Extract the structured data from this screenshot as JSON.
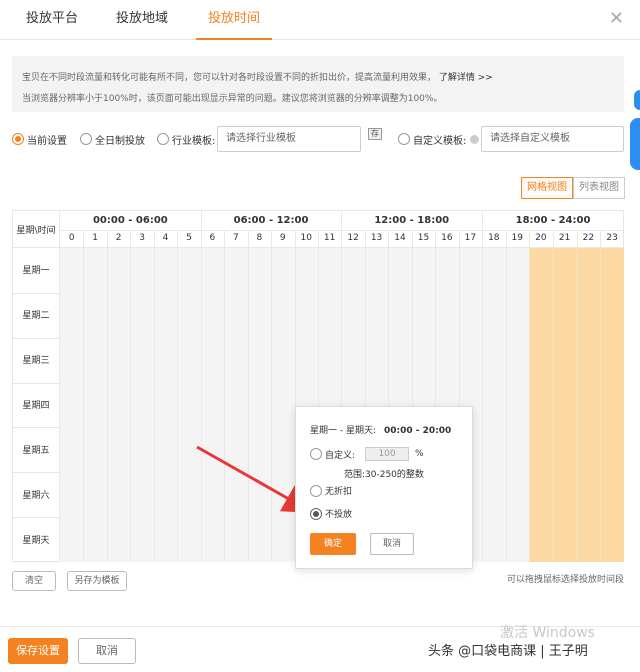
{
  "tabs": [
    "投放平台",
    "投放地域",
    "投放时间"
  ],
  "notice": {
    "line1": "宝贝在不同时段流量和转化可能有所不同，您可以针对各时段设置不同的折扣出价，提高流量利用效果，",
    "link": "了解详情 >>",
    "line2": "当浏览器分辨率小于100%时，该页面可能出现显示异常的问题。建议您将浏览器的分辨率调整为100%。"
  },
  "options": {
    "current": "当前设置",
    "allday": "全日制投放",
    "industry": "行业模板:",
    "industry_placeholder": "请选择行业模板",
    "custom": "自定义模板:",
    "custom_placeholder": "请选择自定义模板",
    "save_icon": "存"
  },
  "views": {
    "grid": "网格视图",
    "list": "列表视图"
  },
  "grid": {
    "corner": "星期\\时间",
    "periods": [
      "00:00 - 06:00",
      "06:00 - 12:00",
      "12:00 - 18:00",
      "18:00 - 24:00"
    ],
    "hours": [
      "0",
      "1",
      "2",
      "3",
      "4",
      "5",
      "6",
      "7",
      "8",
      "9",
      "10",
      "11",
      "12",
      "13",
      "14",
      "15",
      "16",
      "17",
      "18",
      "19",
      "20",
      "21",
      "22",
      "23"
    ],
    "days": [
      "星期一",
      "星期二",
      "星期三",
      "星期四",
      "星期五",
      "星期六",
      "星期天"
    ],
    "selected_hours_from": 20,
    "colors": {
      "selected": "#fcd9a2",
      "unselected": "#f4f4f4",
      "accent": "#f58220"
    }
  },
  "bottom": {
    "clear": "清空",
    "save_template": "另存为模板",
    "hint": "可以拖拽鼠标选择投放时间段"
  },
  "popup": {
    "range_label": "星期一 - 星期天:",
    "range_time": "00:00 - 20:00",
    "custom": "自定义:",
    "custom_value": "100",
    "percent": "%",
    "range_note": "范围:30-250的整数",
    "no_discount": "无折扣",
    "no_delivery": "不投放",
    "confirm": "确定",
    "cancel": "取消"
  },
  "footer": {
    "save": "保存设置",
    "cancel": "取消"
  },
  "watermark": "激活 Windows",
  "credit": "头条 @口袋电商课 | 王子明"
}
